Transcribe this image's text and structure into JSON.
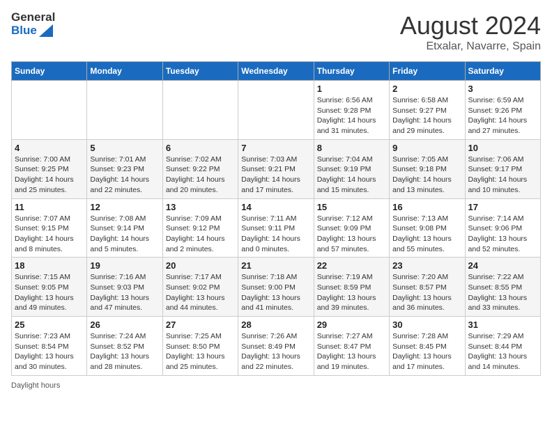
{
  "header": {
    "logo_general": "General",
    "logo_blue": "Blue",
    "month_year": "August 2024",
    "location": "Etxalar, Navarre, Spain"
  },
  "calendar": {
    "days_of_week": [
      "Sunday",
      "Monday",
      "Tuesday",
      "Wednesday",
      "Thursday",
      "Friday",
      "Saturday"
    ],
    "weeks": [
      [
        {
          "day": "",
          "info": ""
        },
        {
          "day": "",
          "info": ""
        },
        {
          "day": "",
          "info": ""
        },
        {
          "day": "",
          "info": ""
        },
        {
          "day": "1",
          "info": "Sunrise: 6:56 AM\nSunset: 9:28 PM\nDaylight: 14 hours and 31 minutes."
        },
        {
          "day": "2",
          "info": "Sunrise: 6:58 AM\nSunset: 9:27 PM\nDaylight: 14 hours and 29 minutes."
        },
        {
          "day": "3",
          "info": "Sunrise: 6:59 AM\nSunset: 9:26 PM\nDaylight: 14 hours and 27 minutes."
        }
      ],
      [
        {
          "day": "4",
          "info": "Sunrise: 7:00 AM\nSunset: 9:25 PM\nDaylight: 14 hours and 25 minutes."
        },
        {
          "day": "5",
          "info": "Sunrise: 7:01 AM\nSunset: 9:23 PM\nDaylight: 14 hours and 22 minutes."
        },
        {
          "day": "6",
          "info": "Sunrise: 7:02 AM\nSunset: 9:22 PM\nDaylight: 14 hours and 20 minutes."
        },
        {
          "day": "7",
          "info": "Sunrise: 7:03 AM\nSunset: 9:21 PM\nDaylight: 14 hours and 17 minutes."
        },
        {
          "day": "8",
          "info": "Sunrise: 7:04 AM\nSunset: 9:19 PM\nDaylight: 14 hours and 15 minutes."
        },
        {
          "day": "9",
          "info": "Sunrise: 7:05 AM\nSunset: 9:18 PM\nDaylight: 14 hours and 13 minutes."
        },
        {
          "day": "10",
          "info": "Sunrise: 7:06 AM\nSunset: 9:17 PM\nDaylight: 14 hours and 10 minutes."
        }
      ],
      [
        {
          "day": "11",
          "info": "Sunrise: 7:07 AM\nSunset: 9:15 PM\nDaylight: 14 hours and 8 minutes."
        },
        {
          "day": "12",
          "info": "Sunrise: 7:08 AM\nSunset: 9:14 PM\nDaylight: 14 hours and 5 minutes."
        },
        {
          "day": "13",
          "info": "Sunrise: 7:09 AM\nSunset: 9:12 PM\nDaylight: 14 hours and 2 minutes."
        },
        {
          "day": "14",
          "info": "Sunrise: 7:11 AM\nSunset: 9:11 PM\nDaylight: 14 hours and 0 minutes."
        },
        {
          "day": "15",
          "info": "Sunrise: 7:12 AM\nSunset: 9:09 PM\nDaylight: 13 hours and 57 minutes."
        },
        {
          "day": "16",
          "info": "Sunrise: 7:13 AM\nSunset: 9:08 PM\nDaylight: 13 hours and 55 minutes."
        },
        {
          "day": "17",
          "info": "Sunrise: 7:14 AM\nSunset: 9:06 PM\nDaylight: 13 hours and 52 minutes."
        }
      ],
      [
        {
          "day": "18",
          "info": "Sunrise: 7:15 AM\nSunset: 9:05 PM\nDaylight: 13 hours and 49 minutes."
        },
        {
          "day": "19",
          "info": "Sunrise: 7:16 AM\nSunset: 9:03 PM\nDaylight: 13 hours and 47 minutes."
        },
        {
          "day": "20",
          "info": "Sunrise: 7:17 AM\nSunset: 9:02 PM\nDaylight: 13 hours and 44 minutes."
        },
        {
          "day": "21",
          "info": "Sunrise: 7:18 AM\nSunset: 9:00 PM\nDaylight: 13 hours and 41 minutes."
        },
        {
          "day": "22",
          "info": "Sunrise: 7:19 AM\nSunset: 8:59 PM\nDaylight: 13 hours and 39 minutes."
        },
        {
          "day": "23",
          "info": "Sunrise: 7:20 AM\nSunset: 8:57 PM\nDaylight: 13 hours and 36 minutes."
        },
        {
          "day": "24",
          "info": "Sunrise: 7:22 AM\nSunset: 8:55 PM\nDaylight: 13 hours and 33 minutes."
        }
      ],
      [
        {
          "day": "25",
          "info": "Sunrise: 7:23 AM\nSunset: 8:54 PM\nDaylight: 13 hours and 30 minutes."
        },
        {
          "day": "26",
          "info": "Sunrise: 7:24 AM\nSunset: 8:52 PM\nDaylight: 13 hours and 28 minutes."
        },
        {
          "day": "27",
          "info": "Sunrise: 7:25 AM\nSunset: 8:50 PM\nDaylight: 13 hours and 25 minutes."
        },
        {
          "day": "28",
          "info": "Sunrise: 7:26 AM\nSunset: 8:49 PM\nDaylight: 13 hours and 22 minutes."
        },
        {
          "day": "29",
          "info": "Sunrise: 7:27 AM\nSunset: 8:47 PM\nDaylight: 13 hours and 19 minutes."
        },
        {
          "day": "30",
          "info": "Sunrise: 7:28 AM\nSunset: 8:45 PM\nDaylight: 13 hours and 17 minutes."
        },
        {
          "day": "31",
          "info": "Sunrise: 7:29 AM\nSunset: 8:44 PM\nDaylight: 13 hours and 14 minutes."
        }
      ]
    ]
  },
  "footer": {
    "note": "Daylight hours"
  }
}
